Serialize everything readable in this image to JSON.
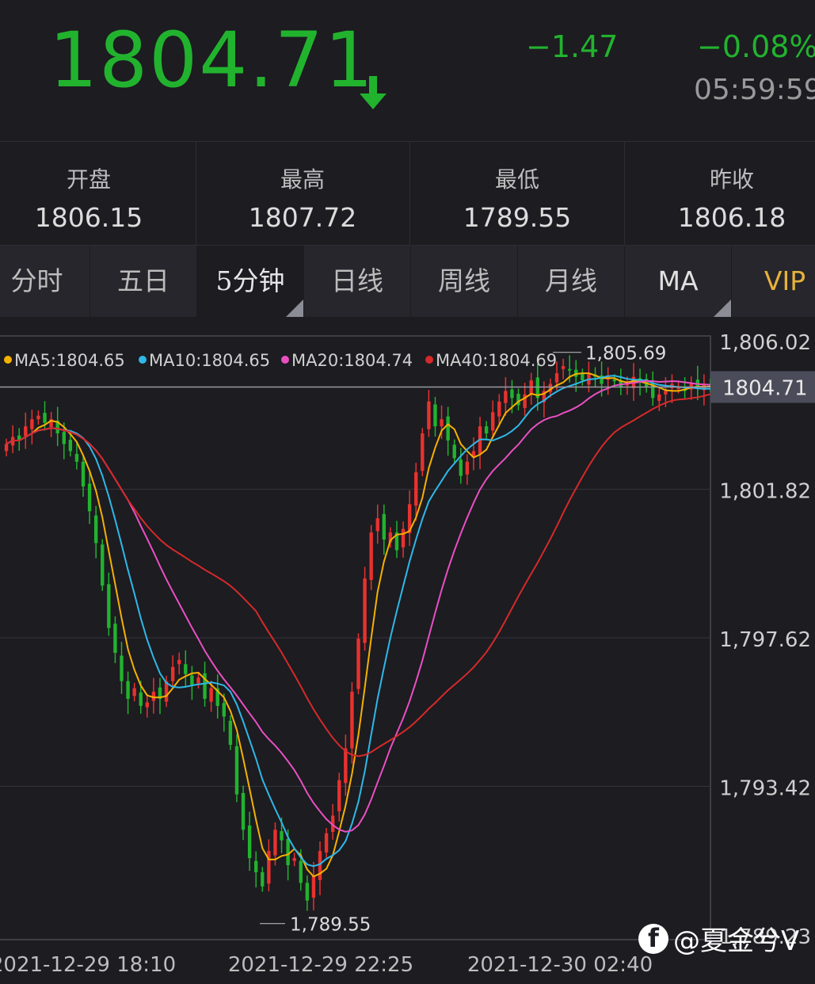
{
  "header": {
    "price": "1804.71",
    "change": "−1.47",
    "change_pct": "−0.08%",
    "time": "05:59:59"
  },
  "stats": [
    {
      "label": "开盘",
      "value": "1806.15"
    },
    {
      "label": "最高",
      "value": "1807.72"
    },
    {
      "label": "最低",
      "value": "1789.55"
    },
    {
      "label": "昨收",
      "value": "1806.18"
    }
  ],
  "tabs": [
    "分时",
    "五日",
    "5分钟",
    "日线",
    "周线",
    "月线",
    "MA",
    "VIP"
  ],
  "active_tab": "5分钟",
  "colors": {
    "up": "#e8322f",
    "down": "#22b32e",
    "ma5": "#f5b100",
    "ma10": "#2fb8e8",
    "ma20": "#ea4fc2",
    "ma40": "#d42a2a"
  },
  "watermark": "@夏金兮V",
  "chart_data": {
    "type": "candlestick",
    "interval": "5分钟",
    "ylim": [
      1789.23,
      1806.02
    ],
    "y_ticks": [
      "1,806.02",
      "1,801.82",
      "1,797.62",
      "1,793.42",
      "1,789.23"
    ],
    "x_ticks": [
      "2021-12-29 18:10",
      "2021-12-29 22:25",
      "2021-12-30 02:40"
    ],
    "legend": [
      {
        "name": "MA5",
        "value": "1804.65"
      },
      {
        "name": "MA10",
        "value": "1804.65"
      },
      {
        "name": "MA20",
        "value": "1804.74"
      },
      {
        "name": "MA40",
        "value": "1804.69"
      }
    ],
    "current_price_label": "1804.71",
    "current_price": 1804.71,
    "annotations": [
      {
        "text": "1,805.69",
        "value": 1805.69
      },
      {
        "text": "1,789.55",
        "value": 1789.55
      }
    ],
    "close": [
      1803.1,
      1803.3,
      1803.2,
      1803.6,
      1803.8,
      1803.9,
      1803.7,
      1803.8,
      1803.4,
      1803.1,
      1802.9,
      1802.6,
      1801.9,
      1801.2,
      1800.3,
      1799.1,
      1797.9,
      1797.2,
      1796.4,
      1795.9,
      1796.2,
      1795.7,
      1795.8,
      1796.1,
      1795.9,
      1796.4,
      1796.8,
      1797.0,
      1796.6,
      1796.3,
      1796.5,
      1795.9,
      1796.2,
      1795.7,
      1795.4,
      1794.6,
      1793.2,
      1792.2,
      1791.4,
      1791.0,
      1790.6,
      1791.6,
      1792.2,
      1791.9,
      1791.2,
      1791.4,
      1790.7,
      1790.2,
      1790.9,
      1791.6,
      1792.1,
      1792.6,
      1793.6,
      1794.5,
      1796.1,
      1797.6,
      1799.3,
      1800.6,
      1801.0,
      1800.4,
      1800.6,
      1800.1,
      1800.7,
      1801.4,
      1802.3,
      1803.4,
      1804.3,
      1803.6,
      1803.8,
      1803.2,
      1802.7,
      1802.2,
      1802.6,
      1802.9,
      1803.6,
      1803.4,
      1804.0,
      1804.3,
      1804.6,
      1804.4,
      1804.2,
      1804.5,
      1804.9,
      1804.4,
      1804.6,
      1804.8,
      1805.1,
      1805.3,
      1805.2,
      1805.0,
      1804.9,
      1805.1,
      1805.0,
      1804.8,
      1805.0,
      1804.9,
      1804.7,
      1804.8,
      1805.0,
      1804.9,
      1804.7,
      1804.4,
      1804.5,
      1804.6,
      1804.8,
      1804.7,
      1804.6,
      1804.8,
      1804.7,
      1804.8,
      1804.71
    ]
  }
}
